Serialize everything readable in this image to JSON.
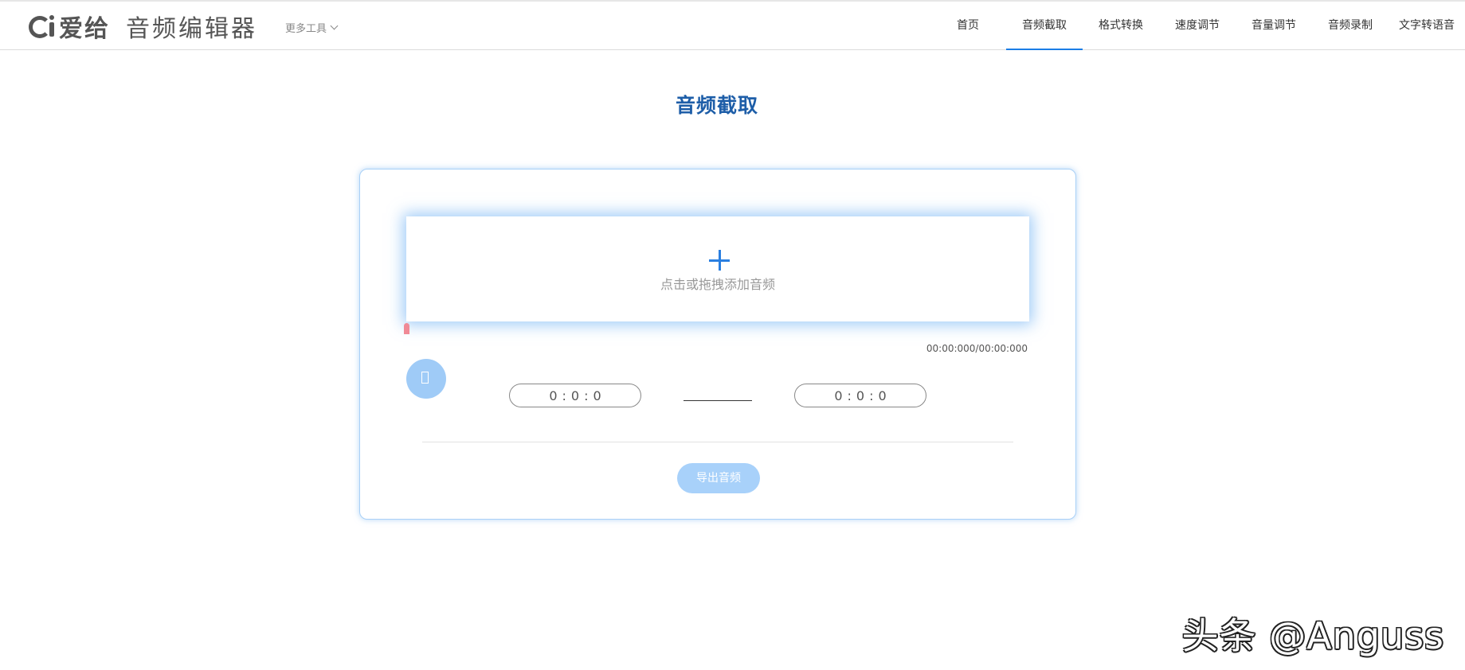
{
  "header": {
    "logo_brand": "爱给",
    "logo_product": "音频编辑器",
    "more_tools": "更多工具",
    "nav": [
      {
        "label": "首页",
        "active": false
      },
      {
        "label": "音频截取",
        "active": true
      },
      {
        "label": "格式转换",
        "active": false
      },
      {
        "label": "速度调节",
        "active": false
      },
      {
        "label": "音量调节",
        "active": false
      },
      {
        "label": "音频录制",
        "active": false
      },
      {
        "label": "文字转语音",
        "active": false
      }
    ]
  },
  "page": {
    "title": "音频截取"
  },
  "editor": {
    "drop_text": "点击或拖拽添加音频",
    "timecode": "00:00:000/00:00:000",
    "start_time": {
      "h": "0",
      "m": "0",
      "s": "0"
    },
    "end_time": {
      "h": "0",
      "m": "0",
      "s": "0"
    },
    "export_label": "导出音频"
  },
  "watermark": "头条 @Anguss",
  "colors": {
    "accent": "#1a7de6",
    "title": "#1e5ea8",
    "button": "#a8d1fa",
    "marker": "#f08a96"
  },
  "icons": {
    "logo": "aigei-logo-icon",
    "more_tools": "chevron-down-icon",
    "add": "plus-icon",
    "play": "play-icon",
    "marker": "playhead-marker-icon"
  }
}
